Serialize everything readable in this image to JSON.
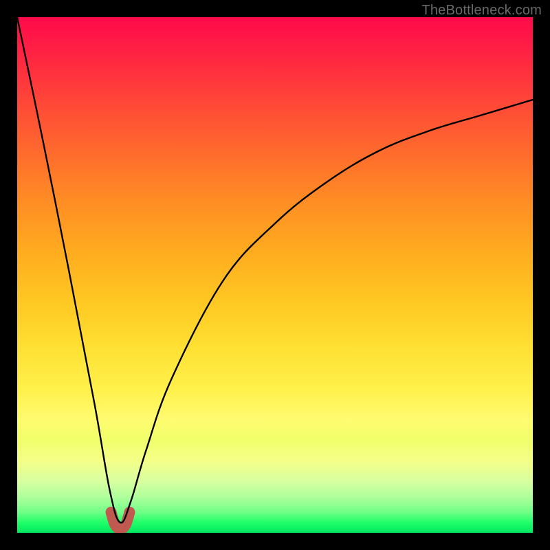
{
  "watermark": "TheBottleneck.com",
  "colors": {
    "frame": "#000000",
    "curve": "#000000",
    "notch": "#c05a50"
  },
  "chart_data": {
    "type": "line",
    "title": "",
    "xlabel": "",
    "ylabel": "",
    "xlim": [
      0,
      100
    ],
    "ylim": [
      0,
      100
    ],
    "grid": false,
    "legend": false,
    "description": "Bottleneck-style V-curve over a green→red vertical gradient. The y-axis direction represents mismatch (higher = worse / red). The curve dips to ~0 at the optimal x≈20 and rises on both sides.",
    "series": [
      {
        "name": "bottleneck-curve",
        "x": [
          0,
          5,
          10,
          15,
          18,
          20,
          22,
          25,
          30,
          40,
          50,
          60,
          70,
          80,
          90,
          100
        ],
        "values": [
          100,
          76,
          51,
          25,
          8,
          2,
          6,
          16,
          30,
          49,
          60,
          68,
          74,
          78,
          81,
          84
        ]
      }
    ],
    "optimal_x": 20,
    "notch_curve": {
      "x": [
        18.2,
        19,
        20,
        21,
        21.8
      ],
      "values": [
        4.0,
        1.5,
        0.8,
        1.5,
        4.0
      ]
    }
  }
}
